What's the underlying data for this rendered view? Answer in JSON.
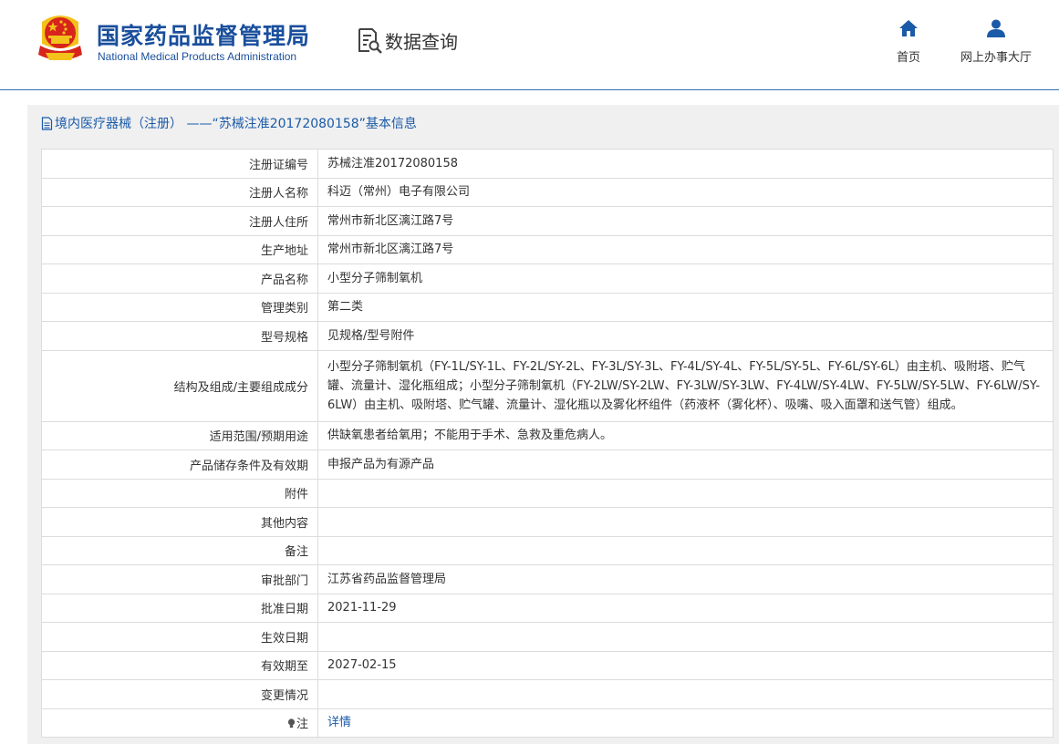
{
  "header": {
    "logo_cn": "国家药品监督管理局",
    "logo_en": "National Medical Products Administration",
    "query_title": "数据查询",
    "nav": [
      {
        "label": "首页",
        "icon": "home-icon"
      },
      {
        "label": "网上办事大厅",
        "icon": "user-icon"
      }
    ]
  },
  "panel": {
    "title": "境内医疗器械（注册） ——“苏械注准20172080158”基本信息"
  },
  "table": {
    "rows": [
      {
        "label": "注册证编号",
        "value": "苏械注准20172080158"
      },
      {
        "label": "注册人名称",
        "value": "科迈（常州）电子有限公司"
      },
      {
        "label": "注册人住所",
        "value": "常州市新北区漓江路7号"
      },
      {
        "label": "生产地址",
        "value": "常州市新北区漓江路7号"
      },
      {
        "label": "产品名称",
        "value": "小型分子筛制氧机"
      },
      {
        "label": "管理类别",
        "value": "第二类"
      },
      {
        "label": "型号规格",
        "value": "见规格/型号附件"
      },
      {
        "label": "结构及组成/主要组成成分",
        "value": "小型分子筛制氧机（FY-1L/SY-1L、FY-2L/SY-2L、FY-3L/SY-3L、FY-4L/SY-4L、FY-5L/SY-5L、FY-6L/SY-6L）由主机、吸附塔、贮气罐、流量计、湿化瓶组成；小型分子筛制氧机（FY-2LW/SY-2LW、FY-3LW/SY-3LW、FY-4LW/SY-4LW、FY-5LW/SY-5LW、FY-6LW/SY-6LW）由主机、吸附塔、贮气罐、流量计、湿化瓶以及雾化杯组件（药液杯（雾化杯）、吸嘴、吸入面罩和送气管）组成。"
      },
      {
        "label": "适用范围/预期用途",
        "value": "供缺氧患者给氧用；不能用于手术、急救及重危病人。"
      },
      {
        "label": "产品储存条件及有效期",
        "value": "申报产品为有源产品"
      },
      {
        "label": "附件",
        "value": ""
      },
      {
        "label": "其他内容",
        "value": ""
      },
      {
        "label": "备注",
        "value": ""
      },
      {
        "label": "审批部门",
        "value": "江苏省药品监督管理局"
      },
      {
        "label": "批准日期",
        "value": "2021-11-29"
      },
      {
        "label": "生效日期",
        "value": ""
      },
      {
        "label": "有效期至",
        "value": "2027-02-15"
      },
      {
        "label": "变更情况",
        "value": ""
      }
    ],
    "note_label": "注",
    "note_link": "详情"
  },
  "colors": {
    "brand_blue": "#1a4f9c",
    "link_blue": "#1a5aa8",
    "emblem_red": "#d7241c",
    "emblem_gold": "#f3c21b"
  }
}
